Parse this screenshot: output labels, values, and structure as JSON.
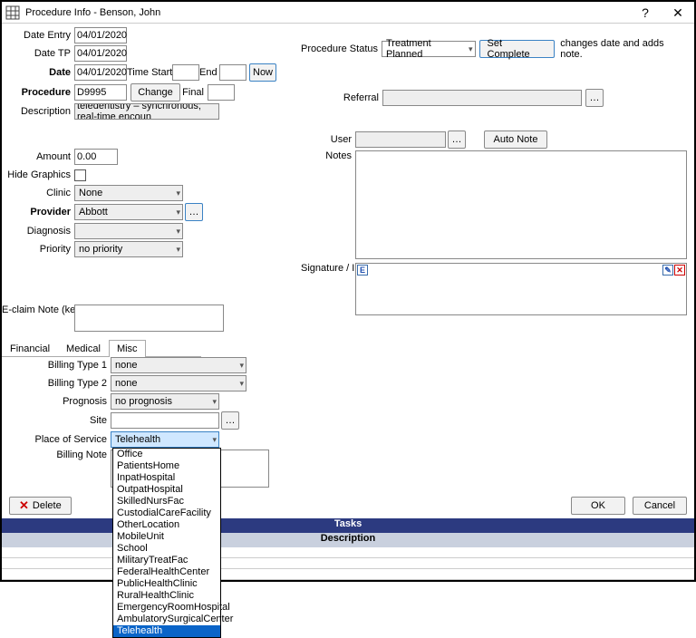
{
  "window": {
    "title": "Procedure Info - Benson, John"
  },
  "left": {
    "date_entry_lbl": "Date Entry",
    "date_entry": "04/01/2020",
    "date_tp_lbl": "Date TP",
    "date_tp": "04/01/2020",
    "date_lbl": "Date",
    "date": "04/01/2020",
    "time_start_lbl": "Time Start",
    "time_start": "",
    "end_lbl": "End",
    "end": "",
    "now_btn": "Now",
    "procedure_lbl": "Procedure",
    "procedure": "D9995",
    "change_btn": "Change",
    "final_lbl": "Final",
    "final": "",
    "description_lbl": "Description",
    "description": "teledentistry – synchronous; real-time encoun",
    "amount_lbl": "Amount",
    "amount": "0.00",
    "hide_graphics_lbl": "Hide Graphics",
    "clinic_lbl": "Clinic",
    "clinic": "None",
    "provider_lbl": "Provider",
    "provider": "Abbott",
    "diagnosis_lbl": "Diagnosis",
    "diagnosis": "",
    "priority_lbl": "Priority",
    "priority": "no priority",
    "eclaim_lbl": "E-claim Note (keep it very short)",
    "eclaim": ""
  },
  "right": {
    "proc_status_lbl": "Procedure Status",
    "proc_status": "Treatment Planned",
    "set_complete_btn": "Set Complete",
    "set_complete_hint": "changes date and adds note.",
    "referral_lbl": "Referral",
    "referral": "",
    "user_lbl": "User",
    "user": "",
    "auto_note_btn": "Auto Note",
    "notes_lbl": "Notes",
    "signature_lbl": "Signature / Initials"
  },
  "tabs": {
    "financial": "Financial",
    "medical": "Medical",
    "misc": "Misc"
  },
  "misc": {
    "billing_type1_lbl": "Billing Type 1",
    "billing_type1": "none",
    "billing_type2_lbl": "Billing Type 2",
    "billing_type2": "none",
    "prognosis_lbl": "Prognosis",
    "prognosis": "no prognosis",
    "site_lbl": "Site",
    "site": "",
    "pos_lbl": "Place of Service",
    "pos": "Telehealth",
    "billing_note_lbl": "Billing Note"
  },
  "pos_options": [
    "Office",
    "PatientsHome",
    "InpatHospital",
    "OutpatHospital",
    "SkilledNursFac",
    "CustodialCareFacility",
    "OtherLocation",
    "MobileUnit",
    "School",
    "MilitaryTreatFac",
    "FederalHealthCenter",
    "PublicHealthClinic",
    "RuralHealthClinic",
    "EmergencyRoomHospital",
    "AmbulatorySurgicalCenter",
    "Telehealth"
  ],
  "pos_selected": "Telehealth",
  "footer": {
    "delete_btn": "Delete",
    "ok_btn": "OK",
    "cancel_btn": "Cancel",
    "tasks_hdr": "Tasks",
    "desc_hdr": "Description"
  }
}
